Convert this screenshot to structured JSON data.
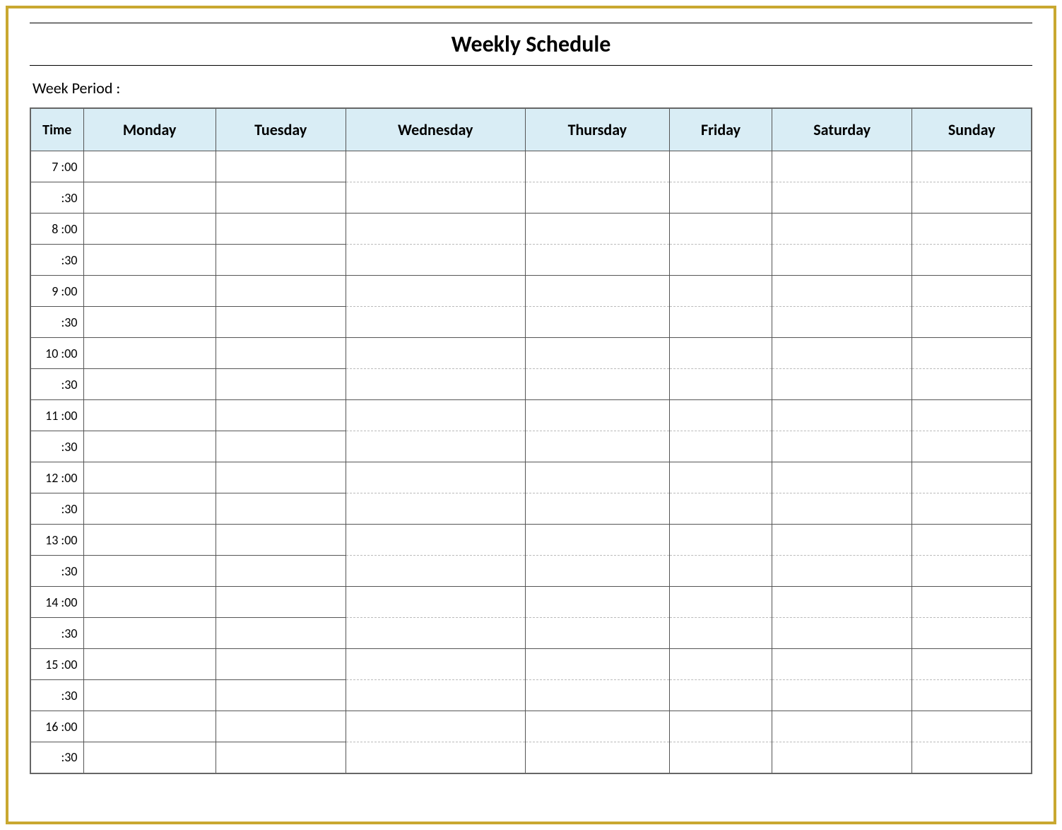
{
  "title": "Weekly Schedule",
  "week_period_label": "Week  Period :",
  "headers": {
    "time": "Time",
    "days": [
      "Monday",
      "Tuesday",
      "Wednesday",
      "Thursday",
      "Friday",
      "Saturday",
      "Sunday"
    ]
  },
  "time_slots": [
    {
      "hour": "7",
      "top": ":00",
      "bottom": ":30"
    },
    {
      "hour": "8",
      "top": ":00",
      "bottom": ":30"
    },
    {
      "hour": "9",
      "top": ":00",
      "bottom": ":30"
    },
    {
      "hour": "10",
      "top": ":00",
      "bottom": ":30"
    },
    {
      "hour": "11",
      "top": ":00",
      "bottom": ":30"
    },
    {
      "hour": "12",
      "top": ":00",
      "bottom": ":30"
    },
    {
      "hour": "13",
      "top": ":00",
      "bottom": ":30"
    },
    {
      "hour": "14",
      "top": ":00",
      "bottom": ":30"
    },
    {
      "hour": "15",
      "top": ":00",
      "bottom": ":30"
    },
    {
      "hour": "16",
      "top": ":00",
      "bottom": ":30"
    }
  ],
  "colors": {
    "border": "#c9a830",
    "header_bg": "#d9edf5"
  }
}
